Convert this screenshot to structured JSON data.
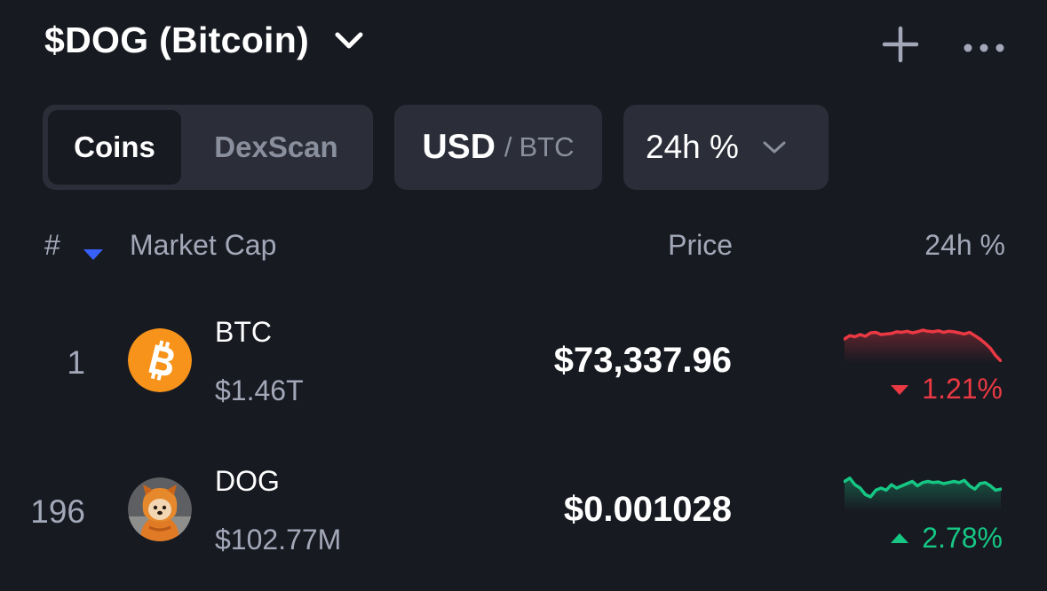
{
  "header": {
    "title": "$DOG (Bitcoin)"
  },
  "tabs": {
    "active_label": "Coins",
    "inactive_label": "DexScan"
  },
  "currency": {
    "primary": "USD",
    "separator": "/",
    "secondary": "BTC"
  },
  "period": {
    "label": "24h %"
  },
  "table": {
    "headers": {
      "rank": "#",
      "market_cap": "Market Cap",
      "price": "Price",
      "change": "24h %"
    },
    "rows": [
      {
        "rank": "1",
        "symbol": "BTC",
        "market_cap": "$1.46T",
        "price": "$73,337.96",
        "change": "1.21%",
        "direction": "down",
        "icon": "bitcoin-logo",
        "sparkline": [
          58,
          52,
          54,
          50,
          53,
          47,
          46,
          50,
          49,
          48,
          45,
          46,
          44,
          47,
          45,
          42,
          44,
          45,
          43,
          46,
          44,
          45,
          47,
          49,
          46,
          52,
          58,
          66,
          75,
          88,
          98
        ]
      },
      {
        "rank": "196",
        "symbol": "DOG",
        "market_cap": "$102.77M",
        "price": "$0.001028",
        "change": "2.78%",
        "direction": "up",
        "icon": "dog-logo",
        "sparkline": [
          46,
          40,
          52,
          58,
          70,
          74,
          62,
          58,
          62,
          52,
          58,
          54,
          50,
          46,
          54,
          48,
          46,
          48,
          47,
          50,
          48,
          46,
          48,
          44,
          54,
          60,
          50,
          48,
          54,
          62,
          60
        ]
      }
    ]
  },
  "colors": {
    "background": "#181a22",
    "pill": "#2b2e38",
    "negative": "#ea3943",
    "positive": "#16c784",
    "sort_accent": "#3861fb",
    "btc_orange": "#f7931a"
  }
}
